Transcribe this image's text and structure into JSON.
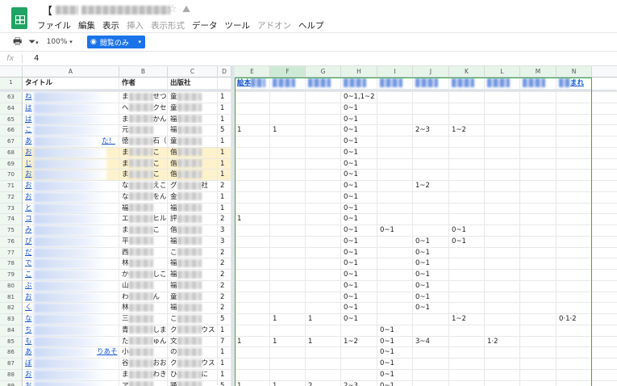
{
  "window": {
    "title_prefix": "【",
    "star_icon": "☆",
    "menu": [
      {
        "label": "ファイル",
        "enabled": true
      },
      {
        "label": "編集",
        "enabled": true
      },
      {
        "label": "表示",
        "enabled": true
      },
      {
        "label": "挿入",
        "enabled": false
      },
      {
        "label": "表示形式",
        "enabled": false
      },
      {
        "label": "データ",
        "enabled": true
      },
      {
        "label": "ツール",
        "enabled": true
      },
      {
        "label": "アドオン",
        "enabled": false
      },
      {
        "label": "ヘルプ",
        "enabled": true
      }
    ]
  },
  "toolbar": {
    "zoom": "100%",
    "view_only_label": "閲覧のみ",
    "accent": "#1a73e8"
  },
  "formula_bar": {
    "fx": "fx",
    "value": "4"
  },
  "columns": [
    "A",
    "B",
    "C",
    "D",
    "E",
    "F",
    "G",
    "H",
    "I",
    "J",
    "K",
    "L",
    "M",
    "N"
  ],
  "header_row": {
    "num": "1",
    "A": "タイトル",
    "B": "作者",
    "C": "出版社",
    "E": "絵本",
    "N": "まれ"
  },
  "rows": [
    {
      "n": "63",
      "a": "ね",
      "b": [
        "ま",
        "せつこ"
      ],
      "c": [
        "童",
        ""
      ],
      "d": "1",
      "v": {
        "H": "0~1,1~2"
      }
    },
    {
      "n": "64",
      "a": "は",
      "b": [
        "へ",
        "クセ"
      ],
      "c": [
        "童",
        ""
      ],
      "d": "1",
      "v": {
        "H": "0~1"
      }
    },
    {
      "n": "65",
      "a": "は",
      "b": [
        "ま",
        "かん"
      ],
      "c": [
        "福",
        ""
      ],
      "d": "1",
      "v": {
        "H": "0~1"
      }
    },
    {
      "n": "66",
      "a": "こ",
      "b": [
        "元",
        ""
      ],
      "c": [
        "福",
        ""
      ],
      "d": "5",
      "v": {
        "E": "1",
        "F": "1",
        "H": "0~1",
        "J": "2~3",
        "K": "1~2"
      }
    },
    {
      "n": "67",
      "a": "あ",
      "a2": "た！",
      "b": [
        "徳",
        "石（"
      ],
      "c": [
        "童",
        ""
      ],
      "d": "1",
      "v": {
        "H": "0~1"
      }
    },
    {
      "n": "68",
      "a": "お",
      "b": [
        "ま",
        "こ"
      ],
      "c": [
        "偕",
        ""
      ],
      "d": "1",
      "v": {
        "H": "0~1"
      },
      "hl": true
    },
    {
      "n": "69",
      "a": "じ",
      "b": [
        "ま",
        "こ"
      ],
      "c": [
        "偕",
        ""
      ],
      "d": "1",
      "v": {
        "H": "0~1"
      },
      "hl": true
    },
    {
      "n": "70",
      "a": "お",
      "b": [
        "ま",
        "こ"
      ],
      "c": [
        "偕",
        ""
      ],
      "d": "1",
      "v": {
        "H": "0~1"
      },
      "hl": true
    },
    {
      "n": "71",
      "a": "お",
      "b": [
        "な",
        "えこ"
      ],
      "c": [
        "グ",
        "社"
      ],
      "d": "2",
      "v": {
        "H": "0~1",
        "J": "1~2"
      }
    },
    {
      "n": "72",
      "a": "お",
      "b": [
        "な",
        "をん"
      ],
      "c": [
        "金",
        ""
      ],
      "d": "1",
      "v": {
        "H": "0~1"
      }
    },
    {
      "n": "73",
      "a": "と",
      "b": [
        "福",
        ""
      ],
      "c": [
        "福",
        ""
      ],
      "d": "1",
      "v": {
        "H": "0~1"
      }
    },
    {
      "n": "74",
      "a": "コ",
      "b": [
        "エ",
        "ヒル"
      ],
      "c": [
        "評",
        ""
      ],
      "d": "2",
      "v": {
        "E": "1",
        "H": "0~1"
      }
    },
    {
      "n": "75",
      "a": "み",
      "b": [
        "ま",
        "こ"
      ],
      "c": [
        "偕",
        ""
      ],
      "d": "3",
      "v": {
        "H": "0~1",
        "I": "0~1",
        "K": "0~1"
      }
    },
    {
      "n": "76",
      "a": "ぴ",
      "b": [
        "平",
        ""
      ],
      "c": [
        "福",
        ""
      ],
      "d": "3",
      "v": {
        "H": "0~1",
        "J": "0~1",
        "K": "0~1"
      }
    },
    {
      "n": "77",
      "a": "だ",
      "b": [
        "西",
        ""
      ],
      "c": [
        "こ",
        ""
      ],
      "d": "2",
      "v": {
        "H": "0~1",
        "J": "0~1"
      }
    },
    {
      "n": "78",
      "a": "で",
      "b": [
        "林",
        ""
      ],
      "c": [
        "福",
        ""
      ],
      "d": "2",
      "v": {
        "H": "0~1",
        "J": "0~1"
      }
    },
    {
      "n": "79",
      "a": "こ",
      "b": [
        "か",
        "しこ"
      ],
      "c": [
        "福",
        ""
      ],
      "d": "2",
      "v": {
        "H": "0~1",
        "J": "0~1"
      }
    },
    {
      "n": "80",
      "a": "ぶ",
      "b": [
        "山",
        ""
      ],
      "c": [
        "福",
        ""
      ],
      "d": "2",
      "v": {
        "H": "0~1",
        "J": "0~1"
      }
    },
    {
      "n": "81",
      "a": "お",
      "b": [
        "わ",
        "ん"
      ],
      "c": [
        "童",
        ""
      ],
      "d": "2",
      "v": {
        "H": "0~1",
        "J": "0~1"
      }
    },
    {
      "n": "82",
      "a": "く",
      "b": [
        "林",
        ""
      ],
      "c": [
        "福",
        ""
      ],
      "d": "2",
      "v": {
        "H": "0~1",
        "J": "0~1"
      }
    },
    {
      "n": "83",
      "a": "な",
      "b": [
        "三",
        ""
      ],
      "c": [
        "こ",
        ""
      ],
      "d": "5",
      "v": {
        "F": "1",
        "G": "1",
        "H": "0~1",
        "K": "1~2",
        "N": "0·1·2"
      }
    },
    {
      "n": "84",
      "a": "ち",
      "b": [
        "青",
        "しま"
      ],
      "c": [
        "ク",
        "ウス"
      ],
      "d": "1",
      "v": {
        "I": "0~1"
      }
    },
    {
      "n": "85",
      "a": "も",
      "b": [
        "た",
        "ゅん"
      ],
      "c": [
        "文",
        ""
      ],
      "d": "7",
      "v": {
        "E": "1",
        "F": "1",
        "G": "1",
        "H": "1~2",
        "I": "0~1",
        "J": "3~4",
        "L": "1·2"
      }
    },
    {
      "n": "86",
      "a": "あ",
      "a2": "りあそ",
      "b": [
        "小",
        ""
      ],
      "c": [
        "の",
        ""
      ],
      "d": "1",
      "v": {
        "I": "0~1"
      }
    },
    {
      "n": "87",
      "a": "ぽ",
      "b": [
        "谷",
        "おお"
      ],
      "c": [
        "ク",
        "ウス"
      ],
      "d": "1",
      "v": {
        "I": "0~1"
      }
    },
    {
      "n": "88",
      "a": "お",
      "b": [
        "ま",
        "わき"
      ],
      "c": [
        "ひ",
        "に"
      ],
      "d": "1",
      "v": {
        "I": "0~1"
      }
    },
    {
      "n": "89",
      "a": "お",
      "b": [
        "ア",
        ""
      ],
      "c": [
        "踊",
        ""
      ],
      "d": "5",
      "v": {
        "E": "1",
        "F": "1",
        "G": "2",
        "H": "2~3",
        "I": "0~1"
      }
    }
  ]
}
